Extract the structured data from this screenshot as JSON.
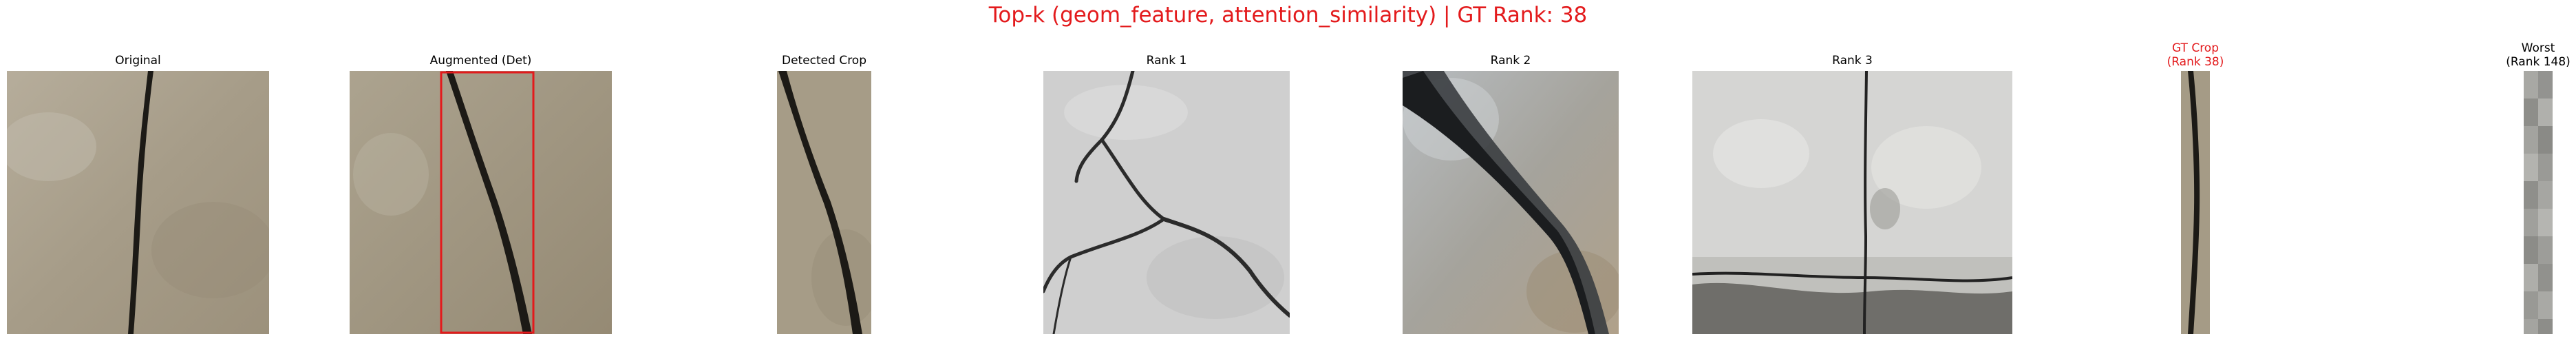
{
  "figure": {
    "title": "Top-k (geom_feature, attention_similarity) | GT Rank: 38",
    "title_color": "#e31a1c"
  },
  "panels": [
    {
      "key": "original",
      "title": "Original",
      "icon": "concrete-crack-image"
    },
    {
      "key": "augmented",
      "title": "Augmented (Det)",
      "icon": "concrete-crack-image-with-detection-box",
      "box_color": "#e31a1c"
    },
    {
      "key": "detected",
      "title": "Detected Crop",
      "icon": "cropped-crack-image"
    },
    {
      "key": "rank1",
      "title": "Rank 1",
      "icon": "white-wall-crack-image"
    },
    {
      "key": "rank2",
      "title": "Rank 2",
      "icon": "stone-crack-image"
    },
    {
      "key": "rank3",
      "title": "Rank 3",
      "icon": "white-paint-crack-image"
    },
    {
      "key": "gt",
      "title_lines": [
        "GT Crop",
        "(Rank 38)"
      ],
      "icon": "narrow-crack-strip-image",
      "title_color": "#e31a1c"
    },
    {
      "key": "worst",
      "title_lines": [
        "Worst",
        "(Rank 148)"
      ],
      "icon": "gray-blocky-strip-image"
    }
  ]
}
